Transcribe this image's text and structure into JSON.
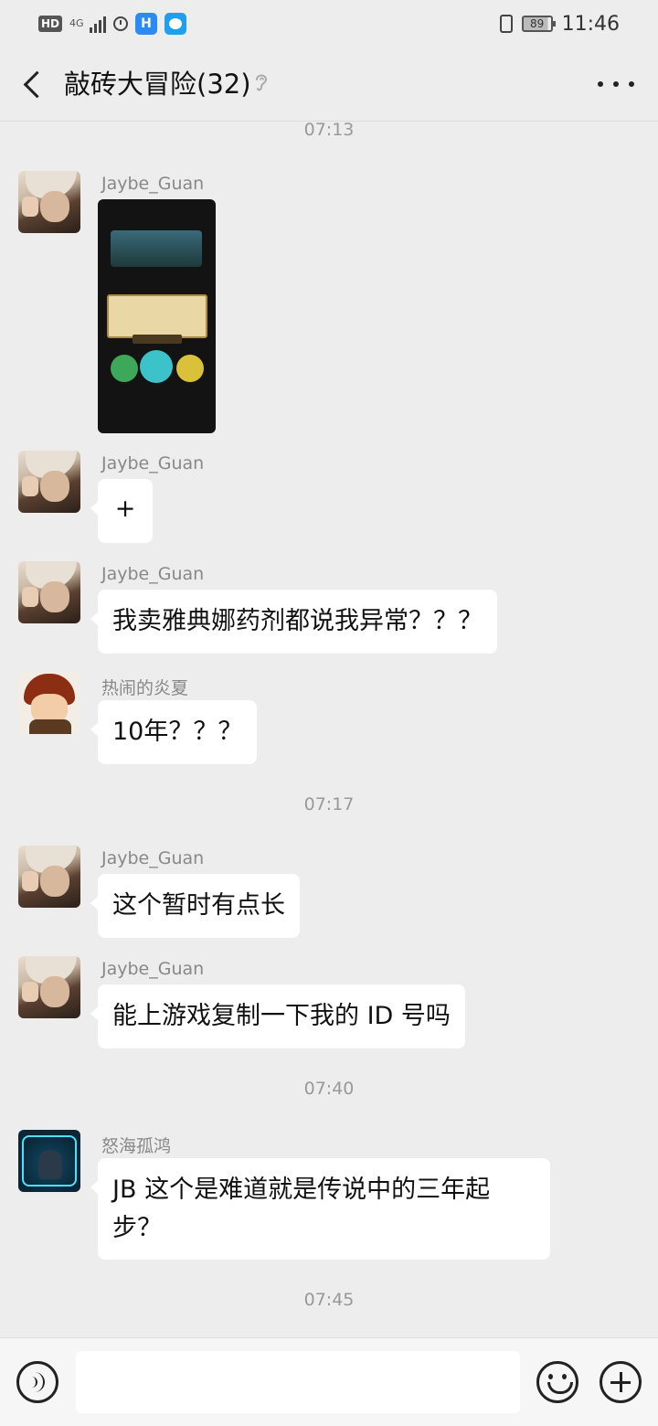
{
  "status_bar": {
    "hd": "HD",
    "network": "4G",
    "app1_glyph": "H",
    "battery": "89",
    "time": "11:46",
    "icons": [
      "hd-icon",
      "signal-icon",
      "timer-icon",
      "app-icon",
      "app-icon",
      "vibrate-icon",
      "battery-icon"
    ]
  },
  "header": {
    "title": "敲砖大冒险(32)",
    "icons": [
      "back-icon",
      "ear-icon",
      "more-icon"
    ]
  },
  "chat": {
    "timestamps": [
      "07:13",
      "07:17",
      "07:40",
      "07:45"
    ],
    "messages": [
      {
        "sender": "Jaybe_Guan",
        "type": "image",
        "image": "game-screenshot"
      },
      {
        "sender": "Jaybe_Guan",
        "type": "text",
        "text": "+"
      },
      {
        "sender": "Jaybe_Guan",
        "type": "text",
        "text": "我卖雅典娜药剂都说我异常？？？"
      },
      {
        "sender": "热闹的炎夏",
        "type": "text",
        "text": "10年？？？"
      },
      {
        "sender": "Jaybe_Guan",
        "type": "text",
        "text": "这个暂时有点长"
      },
      {
        "sender": "Jaybe_Guan",
        "type": "text",
        "text": "能上游戏复制一下我的 ID 号吗"
      },
      {
        "sender": "怒海孤鸿",
        "type": "text",
        "text_line1": "JB 这个是难道就是传说中的三年起",
        "text_line2": "步？"
      }
    ]
  },
  "input_bar": {
    "placeholder": "",
    "icons": [
      "voice-icon",
      "emoji-icon",
      "plus-icon"
    ]
  }
}
